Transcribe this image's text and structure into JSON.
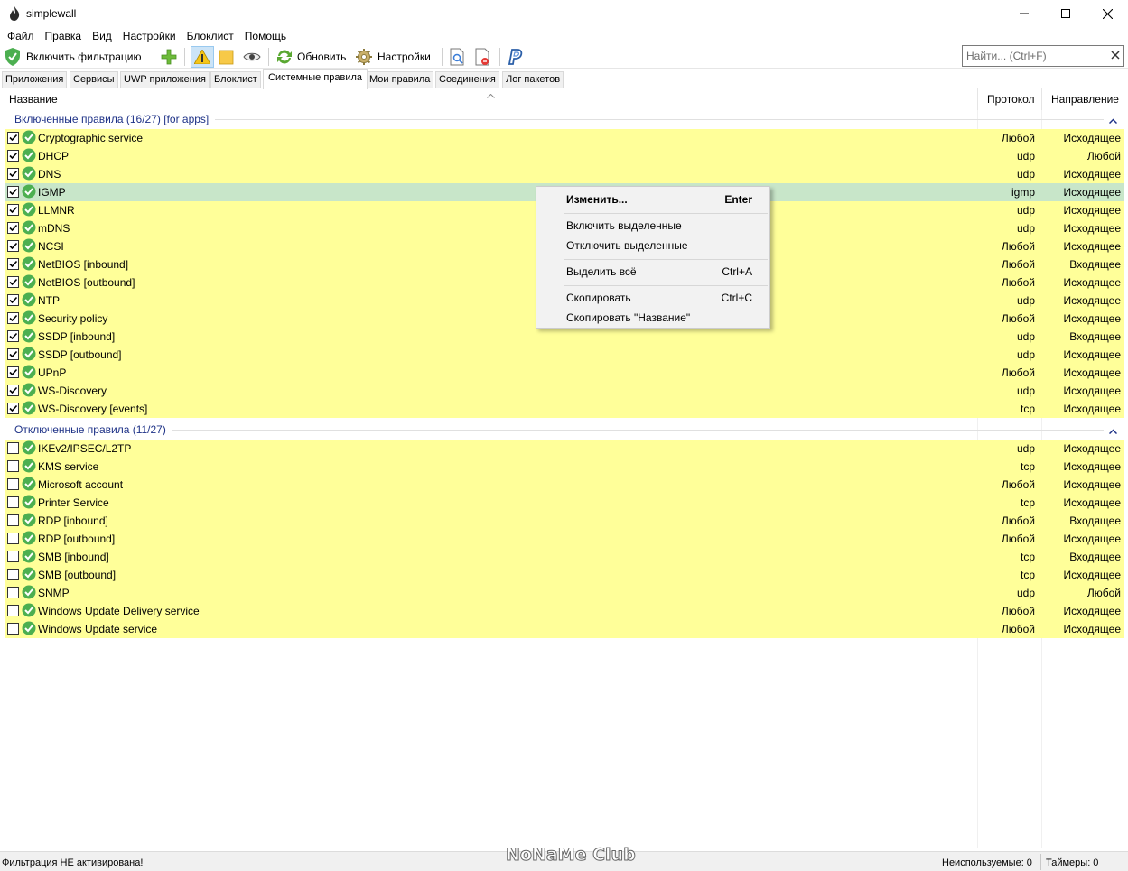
{
  "window": {
    "title": "simplewall"
  },
  "menubar": {
    "items": [
      "Файл",
      "Правка",
      "Вид",
      "Настройки",
      "Блоклист",
      "Помощь"
    ]
  },
  "toolbar": {
    "enable_filtering_label": "Включить фильтрацию",
    "refresh_label": "Обновить",
    "settings_label": "Настройки"
  },
  "search": {
    "placeholder": "Найти... (Ctrl+F)",
    "value": ""
  },
  "tabs": [
    {
      "label": "Приложения",
      "selected": false
    },
    {
      "label": "Сервисы",
      "selected": false
    },
    {
      "label": "UWP приложения",
      "selected": false
    },
    {
      "label": "Блоклист",
      "selected": false
    },
    {
      "label": "Системные правила",
      "selected": true
    },
    {
      "label": "Мои правила",
      "selected": false
    },
    {
      "label": "Соединения",
      "selected": false
    },
    {
      "label": "Лог пакетов",
      "selected": false
    }
  ],
  "columns": {
    "name": "Название",
    "protocol": "Протокол",
    "direction": "Направление"
  },
  "groups": {
    "enabled": {
      "title": "Включенные правила (16/27) [for apps]",
      "rows": [
        {
          "name": "Cryptographic service",
          "protocol": "Любой",
          "direction": "Исходящее",
          "checked": true
        },
        {
          "name": "DHCP",
          "protocol": "udp",
          "direction": "Любой",
          "checked": true
        },
        {
          "name": "DNS",
          "protocol": "udp",
          "direction": "Исходящее",
          "checked": true
        },
        {
          "name": "IGMP",
          "protocol": "igmp",
          "direction": "Исходящее",
          "checked": true,
          "selected": true
        },
        {
          "name": "LLMNR",
          "protocol": "udp",
          "direction": "Исходящее",
          "checked": true
        },
        {
          "name": "mDNS",
          "protocol": "udp",
          "direction": "Исходящее",
          "checked": true
        },
        {
          "name": "NCSI",
          "protocol": "Любой",
          "direction": "Исходящее",
          "checked": true
        },
        {
          "name": "NetBIOS [inbound]",
          "protocol": "Любой",
          "direction": "Входящее",
          "checked": true
        },
        {
          "name": "NetBIOS [outbound]",
          "protocol": "Любой",
          "direction": "Исходящее",
          "checked": true
        },
        {
          "name": "NTP",
          "protocol": "udp",
          "direction": "Исходящее",
          "checked": true
        },
        {
          "name": "Security policy",
          "protocol": "Любой",
          "direction": "Исходящее",
          "checked": true
        },
        {
          "name": "SSDP [inbound]",
          "protocol": "udp",
          "direction": "Входящее",
          "checked": true
        },
        {
          "name": "SSDP [outbound]",
          "protocol": "udp",
          "direction": "Исходящее",
          "checked": true
        },
        {
          "name": "UPnP",
          "protocol": "Любой",
          "direction": "Исходящее",
          "checked": true
        },
        {
          "name": "WS-Discovery",
          "protocol": "udp",
          "direction": "Исходящее",
          "checked": true
        },
        {
          "name": "WS-Discovery [events]",
          "protocol": "tcp",
          "direction": "Исходящее",
          "checked": true
        }
      ]
    },
    "disabled": {
      "title": "Отключенные правила (11/27)",
      "rows": [
        {
          "name": "IKEv2/IPSEC/L2TP",
          "protocol": "udp",
          "direction": "Исходящее",
          "checked": false
        },
        {
          "name": "KMS service",
          "protocol": "tcp",
          "direction": "Исходящее",
          "checked": false
        },
        {
          "name": "Microsoft account",
          "protocol": "Любой",
          "direction": "Исходящее",
          "checked": false
        },
        {
          "name": "Printer Service",
          "protocol": "tcp",
          "direction": "Исходящее",
          "checked": false
        },
        {
          "name": "RDP [inbound]",
          "protocol": "Любой",
          "direction": "Входящее",
          "checked": false
        },
        {
          "name": "RDP [outbound]",
          "protocol": "Любой",
          "direction": "Исходящее",
          "checked": false
        },
        {
          "name": "SMB [inbound]",
          "protocol": "tcp",
          "direction": "Входящее",
          "checked": false
        },
        {
          "name": "SMB [outbound]",
          "protocol": "tcp",
          "direction": "Исходящее",
          "checked": false
        },
        {
          "name": "SNMP",
          "protocol": "udp",
          "direction": "Любой",
          "checked": false
        },
        {
          "name": "Windows Update Delivery service",
          "protocol": "Любой",
          "direction": "Исходящее",
          "checked": false
        },
        {
          "name": "Windows Update service",
          "protocol": "Любой",
          "direction": "Исходящее",
          "checked": false
        }
      ]
    }
  },
  "context_menu": {
    "edit": {
      "label": "Изменить...",
      "shortcut": "Enter"
    },
    "enable_selected": "Включить выделенные",
    "disable_selected": "Отключить выделенные",
    "select_all": {
      "label": "Выделить всё",
      "shortcut": "Ctrl+A"
    },
    "copy": {
      "label": "Скопировать",
      "shortcut": "Ctrl+C"
    },
    "copy_name": "Скопировать \"Название\""
  },
  "statusbar": {
    "filter_status": "Фильтрация НЕ активирована!",
    "unused": "Неиспользуемые: 0",
    "timers": "Таймеры: 0"
  },
  "watermark": "NoNaMe Club",
  "colors": {
    "row_highlight": "#ffff99",
    "row_selected": "#c8e6c9",
    "group_title": "#1e3287",
    "ok_green": "#4caf50"
  }
}
